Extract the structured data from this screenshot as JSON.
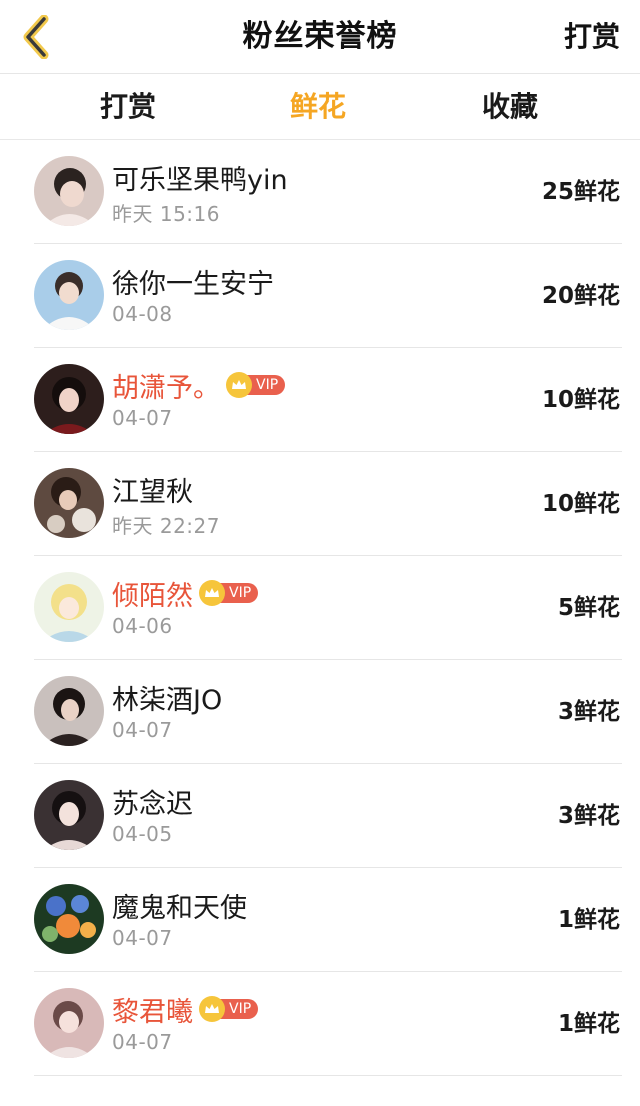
{
  "header": {
    "title": "粉丝荣誉榜",
    "right_label": "打赏",
    "back_icon": "back-chevron-icon"
  },
  "tabs": [
    {
      "label": "打赏",
      "active": false
    },
    {
      "label": "鲜花",
      "active": true
    },
    {
      "label": "收藏",
      "active": false
    }
  ],
  "colors": {
    "accent": "#f5a623",
    "vip_name": "#e8553a",
    "vip_badge": "#e9604d",
    "crown": "#f6c53b"
  },
  "vip_label": "VIP",
  "rows": [
    {
      "name": "可乐坚果鸭yin",
      "time": "昨天 15:16",
      "amount": "25鲜花",
      "vip": false
    },
    {
      "name": "徐你一生安宁",
      "time": "04-08",
      "amount": "20鲜花",
      "vip": false
    },
    {
      "name": "胡潇予。",
      "time": "04-07",
      "amount": "10鲜花",
      "vip": true
    },
    {
      "name": "江望秋",
      "time": "昨天 22:27",
      "amount": "10鲜花",
      "vip": false
    },
    {
      "name": "倾陌然",
      "time": "04-06",
      "amount": "5鲜花",
      "vip": true
    },
    {
      "name": "林柒酒JO",
      "time": "04-07",
      "amount": "3鲜花",
      "vip": false
    },
    {
      "name": "苏念迟",
      "time": "04-05",
      "amount": "3鲜花",
      "vip": false
    },
    {
      "name": "魔鬼和天使",
      "time": "04-07",
      "amount": "1鲜花",
      "vip": false
    },
    {
      "name": "黎君曦",
      "time": "04-07",
      "amount": "1鲜花",
      "vip": true
    }
  ]
}
